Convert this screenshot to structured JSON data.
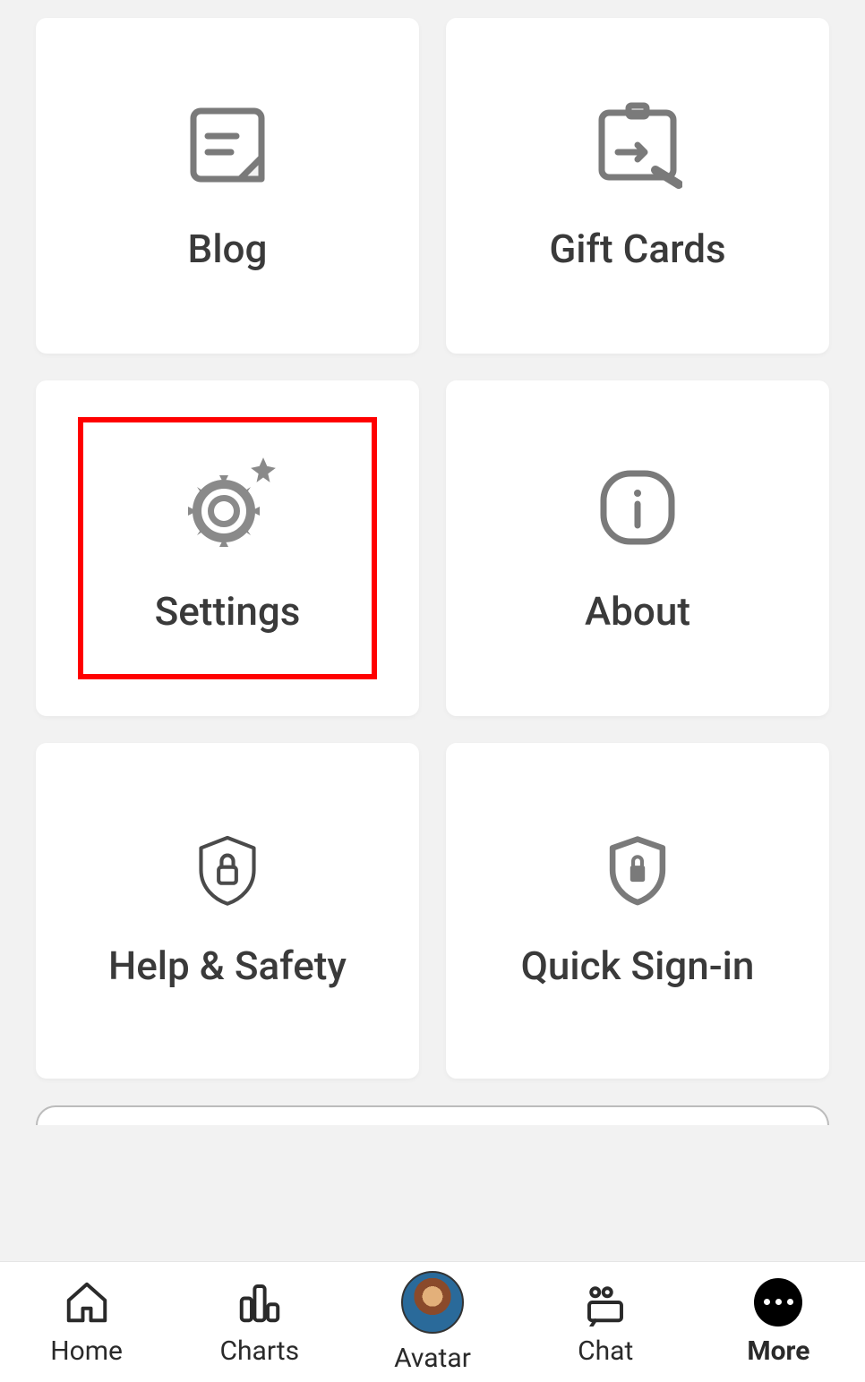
{
  "grid": {
    "items": [
      {
        "label": "Blog",
        "icon": "blog-icon",
        "highlighted": false
      },
      {
        "label": "Gift Cards",
        "icon": "gift-card-icon",
        "highlighted": false
      },
      {
        "label": "Settings",
        "icon": "gear-icon",
        "highlighted": true
      },
      {
        "label": "About",
        "icon": "info-icon",
        "highlighted": false
      },
      {
        "label": "Help & Safety",
        "icon": "shield-lock-outline-icon",
        "highlighted": false
      },
      {
        "label": "Quick Sign-in",
        "icon": "shield-lock-filled-icon",
        "highlighted": false
      }
    ]
  },
  "nav": {
    "items": [
      {
        "label": "Home",
        "icon": "home-icon",
        "active": false
      },
      {
        "label": "Charts",
        "icon": "charts-icon",
        "active": false
      },
      {
        "label": "Avatar",
        "icon": "avatar-image",
        "active": false
      },
      {
        "label": "Chat",
        "icon": "chat-icon",
        "active": false
      },
      {
        "label": "More",
        "icon": "more-icon",
        "active": true
      }
    ]
  },
  "colors": {
    "highlight": "#ff0000",
    "icon": "#7a7a7a",
    "text": "#3a3a3a"
  }
}
